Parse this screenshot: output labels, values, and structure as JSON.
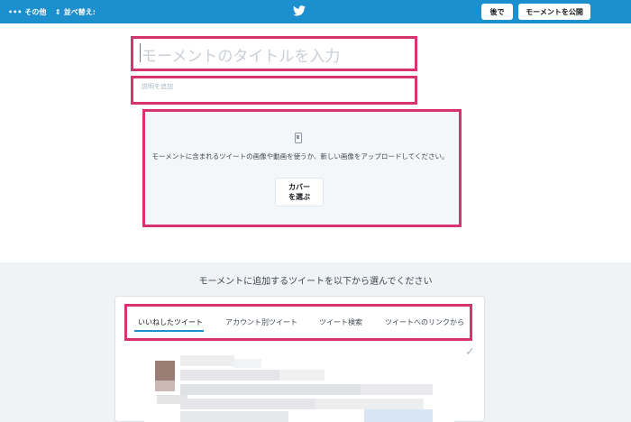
{
  "topbar": {
    "more_glyph": "•••",
    "more_label": "その他",
    "sort_glyph": "⇕",
    "sort_label": "並べ替え:",
    "logo_icon": "twitter-bird-icon",
    "later_label": "後で",
    "publish_label": "モーメントを公開"
  },
  "editor": {
    "title_placeholder": "モーメントのタイトルを入力",
    "description_placeholder": "説明を追加"
  },
  "cover": {
    "icon": "phone-image-icon",
    "description": "モーメントに含まれるツイートの画像や動画を使うか、新しい画像をアップロードしてください。",
    "button_label": "カバーを選ぶ"
  },
  "tweet_picker": {
    "heading": "モーメントに追加するツイートを以下から選んでください",
    "tabs": [
      {
        "label": "いいねしたツイート",
        "active": true
      },
      {
        "label": "アカウント別ツイート",
        "active": false
      },
      {
        "label": "ツイート検索",
        "active": false
      },
      {
        "label": "ツイートへのリンクから",
        "active": false
      }
    ],
    "check_glyph": "✓"
  },
  "colors": {
    "topbar": "#1c8fcf",
    "highlight": "#d6336f",
    "accent": "#1c8fcf"
  }
}
